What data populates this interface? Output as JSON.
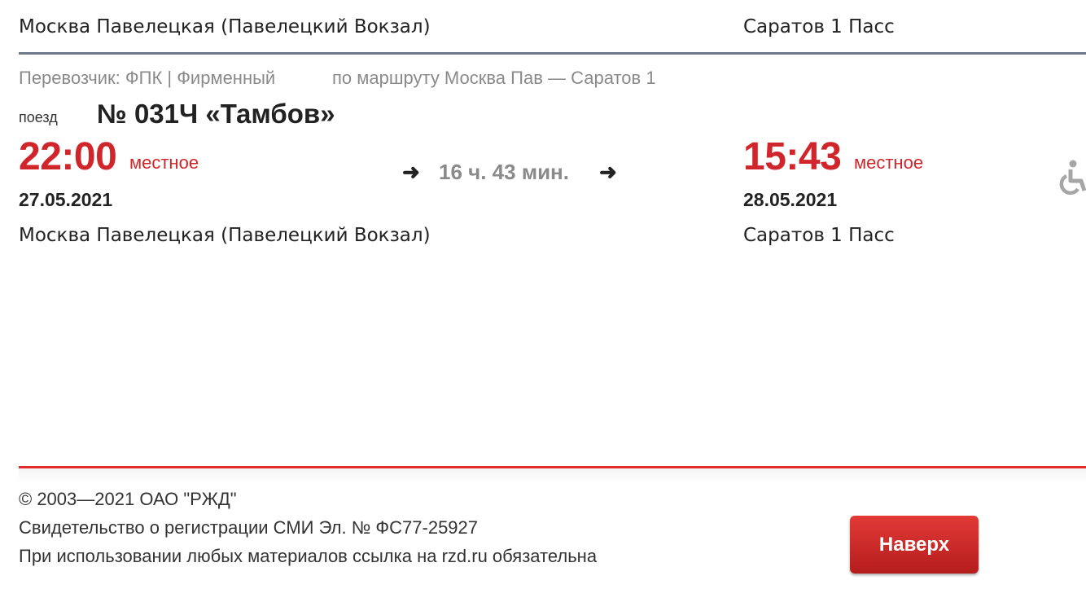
{
  "prev_card": {
    "from_station": "Москва Павелецкая (Павелецкий Вокзал)",
    "to_station": "Саратов 1 Пасс"
  },
  "train": {
    "carrier": "Перевозчик: ФПК | Фирменный",
    "route": "по маршруту Москва Пав — Саратов 1",
    "label": "поезд",
    "number": "№ 031Ч «Тамбов»",
    "departure": {
      "time": "22:00",
      "time_note": "местное",
      "date": "27.05.2021",
      "station": "Москва Павелецкая (Павелецкий Вокзал)"
    },
    "duration": "16 ч. 43 мин.",
    "arrival": {
      "time": "15:43",
      "time_note": "местное",
      "date": "28.05.2021",
      "station": "Саратов 1 Пасс"
    },
    "accessibility_icon": "wheelchair-icon"
  },
  "footer": {
    "copyright": "© 2003—2021  ОАО \"РЖД\"",
    "registration": "Свидетельство о регистрации СМИ Эл. № ФС77-25927",
    "notice": "При использовании любых материалов ссылка на rzd.ru обязательна",
    "top_button": "Наверх"
  },
  "colors": {
    "accent_red": "#d0262b",
    "divider_gray": "#6e7a8a"
  }
}
